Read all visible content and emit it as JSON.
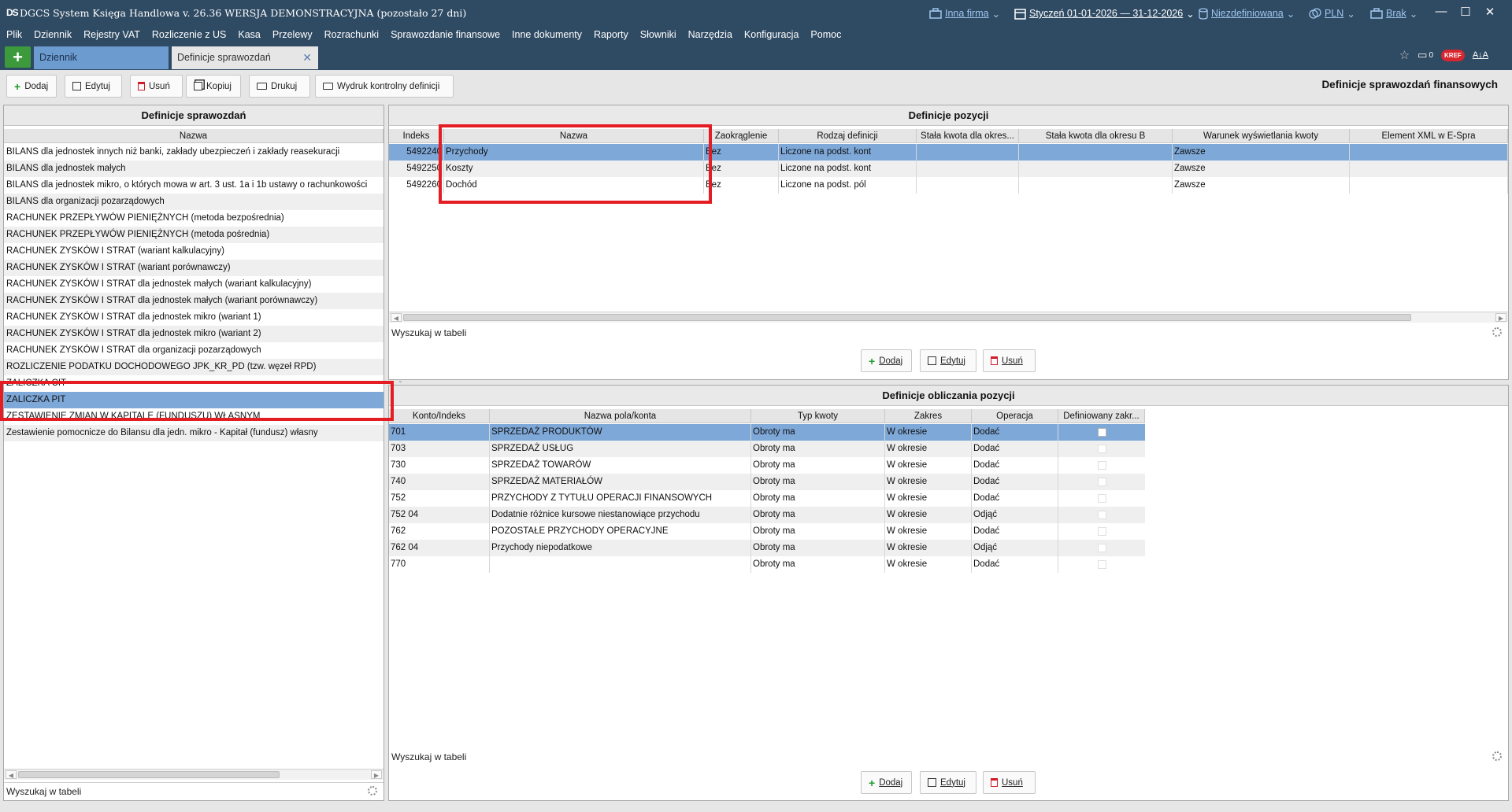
{
  "app": {
    "logo": "DS",
    "title": "DGCS System Księga Handlowa v. 26.36  WERSJA DEMONSTRACYJNA (pozostało 27 dni)",
    "company": "Inna firma",
    "period": "Styczeń 01-01-2026 — 31-12-2026",
    "database": "Niezdefiniowana",
    "currency": "PLN",
    "other": "Brak",
    "colors": {
      "titlebar": "#2f4a63",
      "accent": "#7ea8d8",
      "link": "#9fc6ee",
      "highlight": "#e41c23"
    }
  },
  "menu": [
    "Plik",
    "Dziennik",
    "Rejestry VAT",
    "Rozliczenie z US",
    "Kasa",
    "Przelewy",
    "Rozrachunki",
    "Sprawozdanie finansowe",
    "Inne dokumenty",
    "Raporty",
    "Słowniki",
    "Narzędzia",
    "Konfiguracja",
    "Pomoc"
  ],
  "tabs": {
    "add": "+",
    "dziennik": "Dziennik",
    "definicje": "Definicje sprawozdań",
    "close": "✕"
  },
  "tabstrip_icons": {
    "count": "0",
    "kref": "KREF",
    "font": "A↓A"
  },
  "toolbar": {
    "dodaj": "Dodaj",
    "edytuj": "Edytuj",
    "usun": "Usuń",
    "kopiuj": "Kopiuj",
    "drukuj": "Drukuj",
    "wydruk": "Wydruk kontrolny definicji"
  },
  "page_heading": "Definicje sprawozdań finansowych",
  "left_panel": {
    "title": "Definicje sprawozdań",
    "column": "Nazwa",
    "items": [
      "BILANS dla jednostek innych niż banki, zakłady ubezpieczeń i zakłady reasekuracji",
      "BILANS dla jednostek małych",
      "BILANS dla jednostek mikro, o których mowa w art. 3 ust. 1a i 1b ustawy o rachunkowości",
      "BILANS dla organizacji pozarządowych",
      "RACHUNEK PRZEPŁYWÓW PIENIĘŻNYCH (metoda bezpośrednia)",
      "RACHUNEK PRZEPŁYWÓW PIENIĘŻNYCH (metoda pośrednia)",
      "RACHUNEK ZYSKÓW I STRAT (wariant kalkulacyjny)",
      "RACHUNEK ZYSKÓW I STRAT (wariant porównawczy)",
      "RACHUNEK ZYSKÓW I STRAT dla jednostek małych (wariant kalkulacyjny)",
      "RACHUNEK ZYSKÓW I STRAT dla jednostek małych (wariant porównawczy)",
      "RACHUNEK ZYSKÓW I STRAT dla jednostek mikro (wariant 1)",
      "RACHUNEK ZYSKÓW I STRAT dla jednostek mikro (wariant 2)",
      "RACHUNEK ZYSKÓW I STRAT dla organizacji pozarządowych",
      "ROZLICZENIE PODATKU DOCHODOWEGO JPK_KR_PD (tzw. węzeł RPD)",
      "ZALICZKA CIT",
      "ZALICZKA PIT",
      "ZESTAWIENIE ZMIAN W KAPITALE (FUNDUSZU) WŁASNYM",
      "Zestawienie pomocnicze do Bilansu dla jedn. mikro - Kapitał (fundusz) własny"
    ],
    "search": "Wyszukaj w tabeli"
  },
  "positions": {
    "title": "Definicje pozycji",
    "columns": [
      "Indeks",
      "Nazwa",
      "Zaokrąglenie",
      "Rodzaj definicji",
      "Stała kwota dla okres...",
      "Stała kwota dla okresu B",
      "Warunek wyświetlania kwoty",
      "Element XML w E-Spra"
    ],
    "rows": [
      [
        "5492240",
        "Przychody",
        "Bez",
        "Liczone na podst. kont",
        "",
        "",
        "Zawsze",
        ""
      ],
      [
        "5492250",
        "Koszty",
        "Bez",
        "Liczone na podst. kont",
        "",
        "",
        "Zawsze",
        ""
      ],
      [
        "5492260",
        "Dochód",
        "Bez",
        "Liczone na podst. pól",
        "",
        "",
        "Zawsze",
        ""
      ]
    ],
    "search": "Wyszukaj w tabeli",
    "buttons": {
      "dodaj": "Dodaj",
      "edytuj": "Edytuj",
      "usun": "Usuń"
    }
  },
  "calc": {
    "title": "Definicje obliczania pozycji",
    "columns": [
      "Konto/Indeks",
      "Nazwa pola/konta",
      "Typ kwoty",
      "Zakres",
      "Operacja",
      "Definiowany zakr..."
    ],
    "rows": [
      [
        "701",
        "SPRZEDAŻ PRODUKTÓW",
        "Obroty ma",
        "W okresie",
        "Dodać"
      ],
      [
        "703",
        "SPRZEDAŻ USŁUG",
        "Obroty ma",
        "W okresie",
        "Dodać"
      ],
      [
        "730",
        "SPRZEDAŻ TOWARÓW",
        "Obroty ma",
        "W okresie",
        "Dodać"
      ],
      [
        "740",
        "SPRZEDAŻ MATERIAŁÓW",
        "Obroty ma",
        "W okresie",
        "Dodać"
      ],
      [
        "752",
        "PRZYCHODY Z TYTUŁU OPERACJI FINANSOWYCH",
        "Obroty ma",
        "W okresie",
        "Dodać"
      ],
      [
        "752 04",
        "Dodatnie różnice kursowe niestanowiące przychodu",
        "Obroty ma",
        "W okresie",
        "Odjąć"
      ],
      [
        "762",
        "POZOSTAŁE PRZYCHODY OPERACYJNE",
        "Obroty ma",
        "W okresie",
        "Dodać"
      ],
      [
        "762 04",
        "Przychody niepodatkowe",
        "Obroty ma",
        "W okresie",
        "Odjąć"
      ],
      [
        "770",
        "",
        "Obroty ma",
        "W okresie",
        "Dodać"
      ]
    ],
    "search": "Wyszukaj w tabeli",
    "buttons": {
      "dodaj": "Dodaj",
      "edytuj": "Edytuj",
      "usun": "Usuń"
    }
  }
}
